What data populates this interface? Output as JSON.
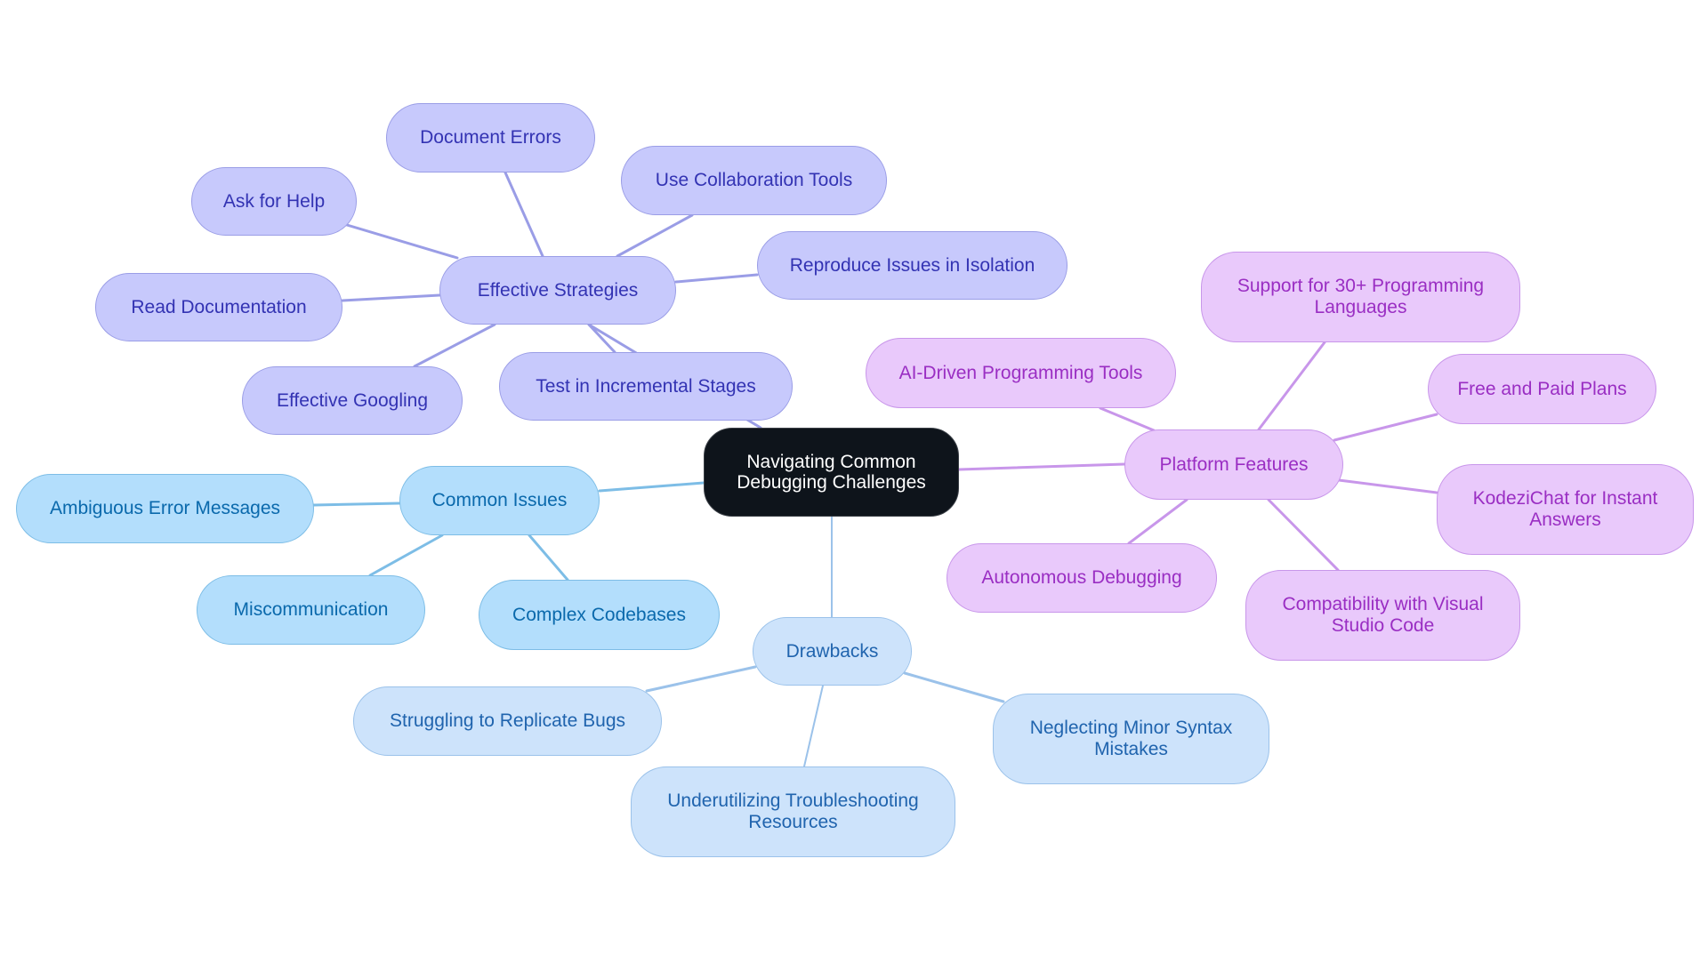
{
  "diagram": {
    "type": "mindmap",
    "root": {
      "id": "root",
      "label": "Navigating Common Debugging Challenges",
      "lines": [
        "Navigating Common",
        "Debugging Challenges"
      ]
    },
    "branches": [
      {
        "id": "strategies",
        "label": "Effective Strategies",
        "color_group": "strat",
        "children": [
          {
            "id": "doc-errors",
            "label": "Document Errors"
          },
          {
            "id": "ask-help",
            "label": "Ask for Help"
          },
          {
            "id": "collab-tools",
            "label": "Use Collaboration Tools"
          },
          {
            "id": "reproduce",
            "label": "Reproduce Issues in Isolation"
          },
          {
            "id": "read-docs",
            "label": "Read Documentation"
          },
          {
            "id": "googling",
            "label": "Effective Googling"
          },
          {
            "id": "incremental",
            "label": "Test in Incremental Stages"
          }
        ]
      },
      {
        "id": "issues",
        "label": "Common Issues",
        "color_group": "issue",
        "children": [
          {
            "id": "ambiguous",
            "label": "Ambiguous Error Messages"
          },
          {
            "id": "miscomm",
            "label": "Miscommunication"
          },
          {
            "id": "complex",
            "label": "Complex Codebases"
          }
        ]
      },
      {
        "id": "drawbacks",
        "label": "Drawbacks",
        "color_group": "draw",
        "children": [
          {
            "id": "struggling",
            "label": "Struggling to Replicate Bugs"
          },
          {
            "id": "underutil",
            "label": "Underutilizing Troubleshooting Resources",
            "lines": [
              "Underutilizing Troubleshooting",
              "Resources"
            ]
          },
          {
            "id": "neglecting",
            "label": "Neglecting Minor Syntax Mistakes",
            "lines": [
              "Neglecting Minor Syntax",
              "Mistakes"
            ]
          }
        ]
      },
      {
        "id": "platform",
        "label": "Platform Features",
        "color_group": "plat",
        "children": [
          {
            "id": "ai-tools",
            "label": "AI-Driven Programming Tools"
          },
          {
            "id": "support30",
            "label": "Support for 30+ Programming Languages",
            "lines": [
              "Support for 30+ Programming",
              "Languages"
            ]
          },
          {
            "id": "plans",
            "label": "Free and Paid Plans"
          },
          {
            "id": "kodezichat",
            "label": "KodeziChat for Instant Answers",
            "lines": [
              "KodeziChat for Instant",
              "Answers"
            ]
          },
          {
            "id": "autonomous",
            "label": "Autonomous Debugging"
          },
          {
            "id": "vscode",
            "label": "Compatibility with Visual Studio Code",
            "lines": [
              "Compatibility with Visual",
              "Studio Code"
            ]
          }
        ]
      }
    ],
    "colors": {
      "root_fill": "#0E141B",
      "root_text": "#FFFFFF",
      "strat_fill": "#C7C9FC",
      "strat_text": "#3333B3",
      "strat_edge": "#9A9DE6",
      "issue_fill": "#B3DEFC",
      "issue_text": "#0A69AC",
      "issue_edge": "#7DBDE6",
      "draw_fill": "#CDE3FB",
      "draw_text": "#2064AE",
      "draw_edge": "#9BC2EA",
      "plat_fill": "#E9C9FB",
      "plat_text": "#9A2EC3",
      "plat_edge": "#C896EA"
    }
  }
}
